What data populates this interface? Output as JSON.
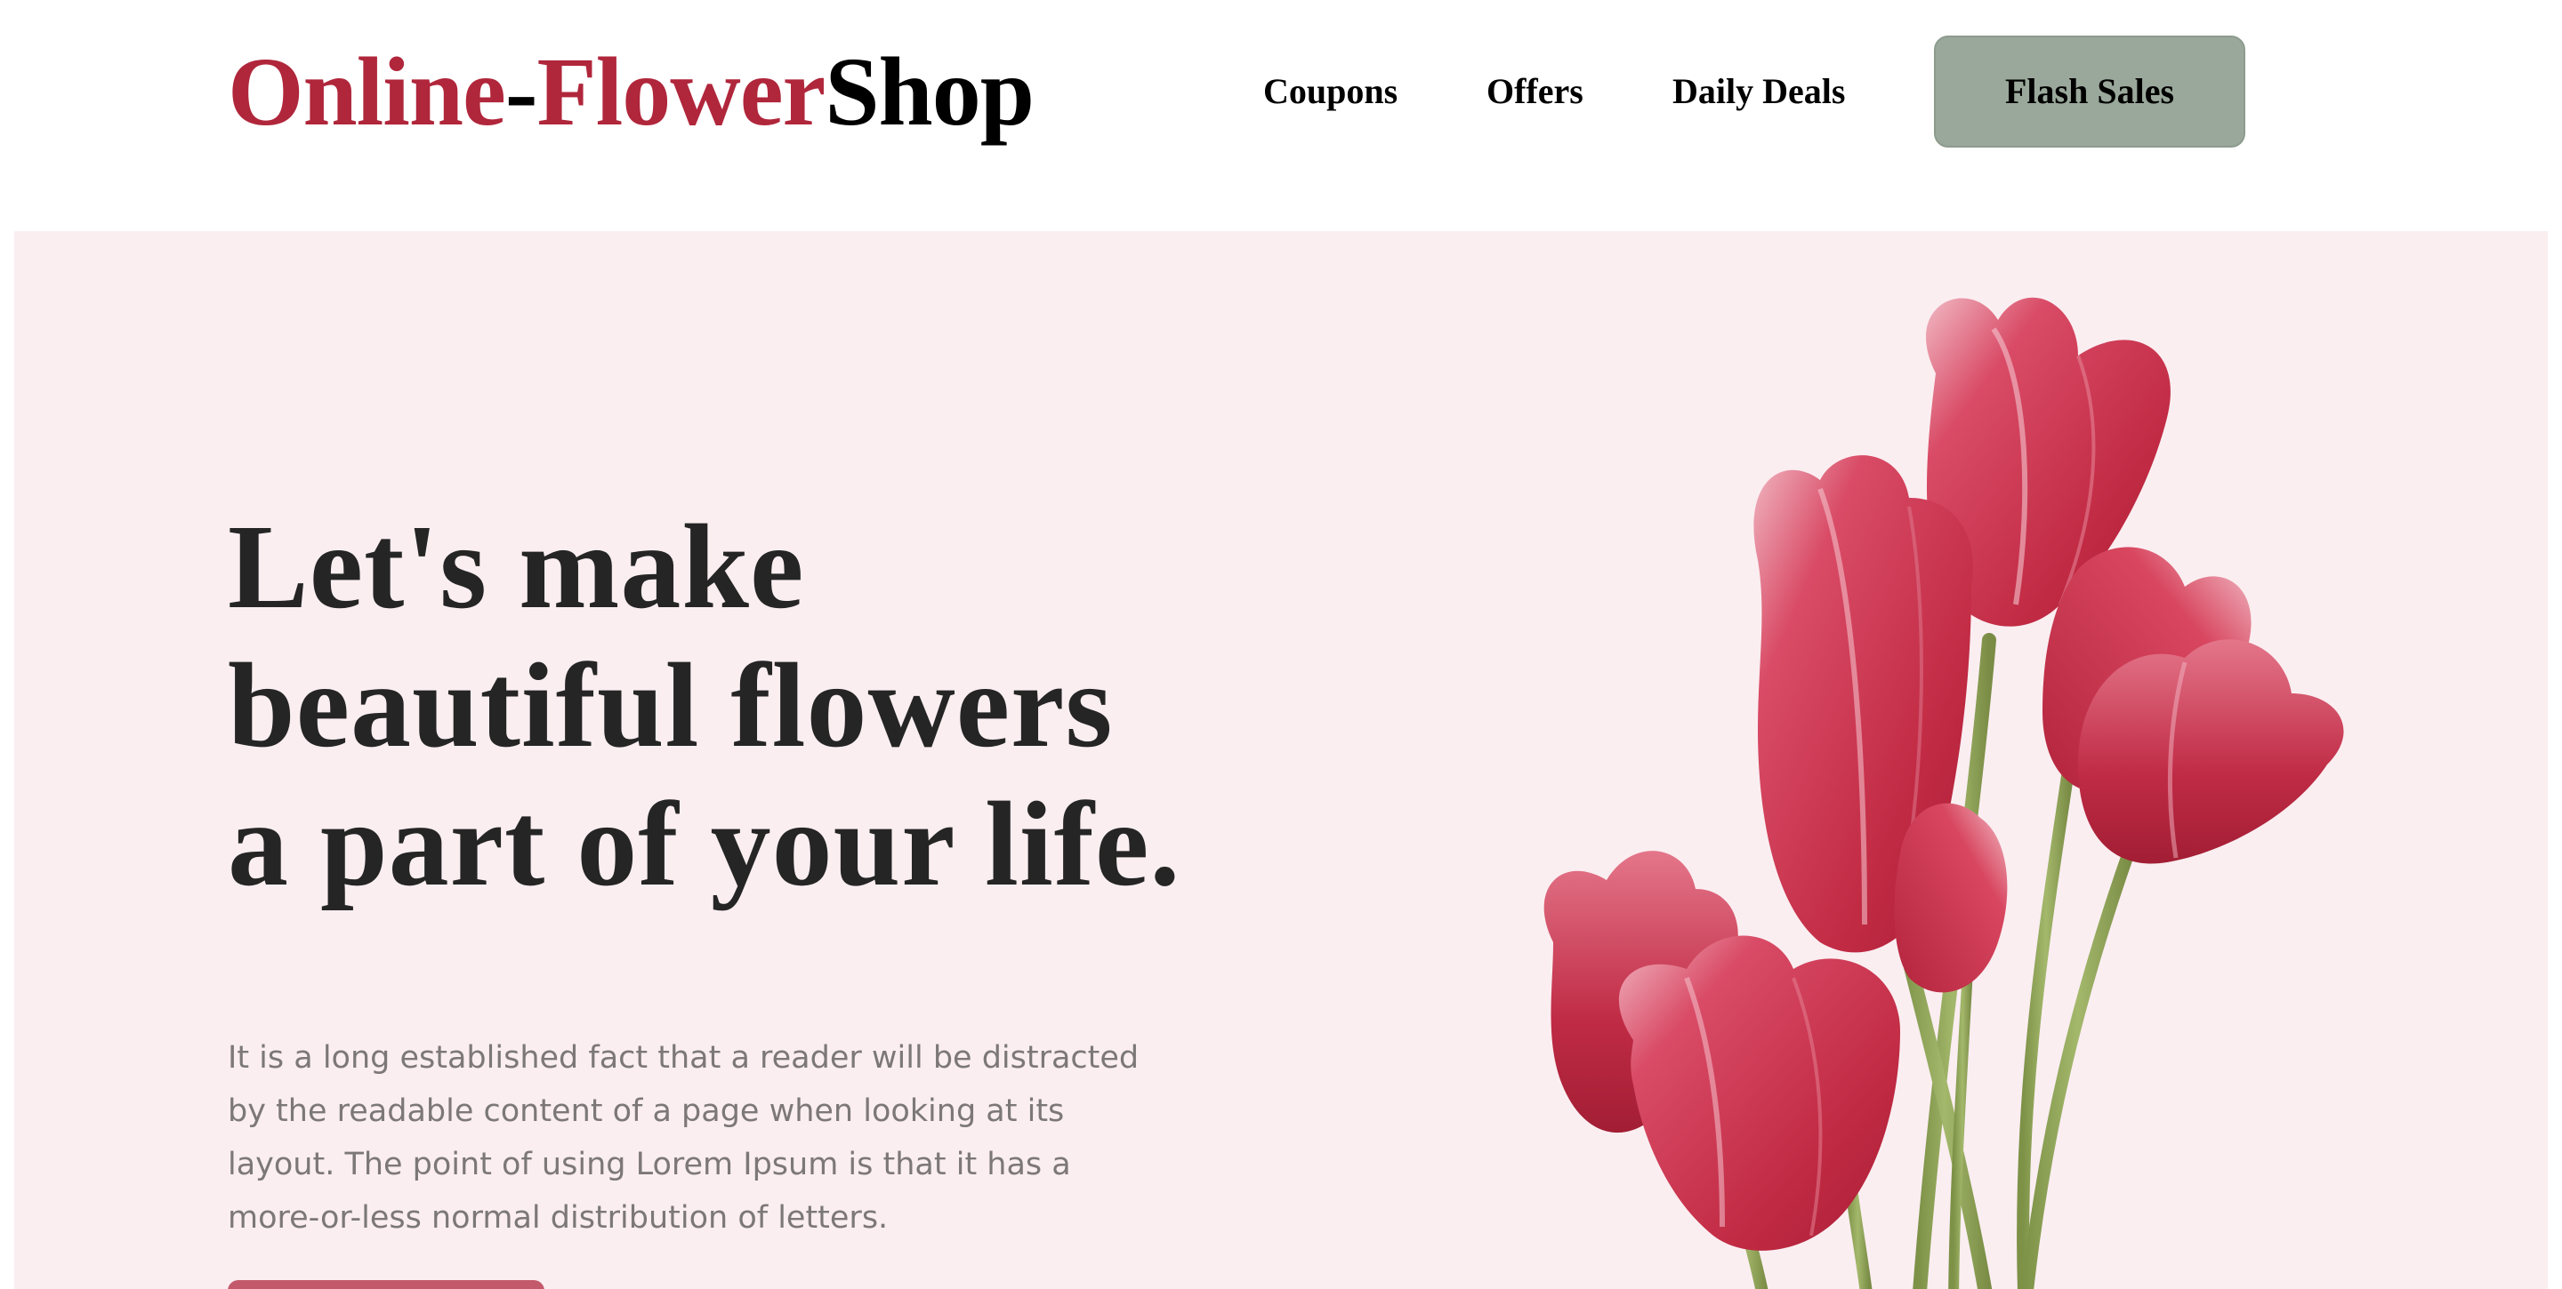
{
  "header": {
    "logo": {
      "part1": "Online",
      "dash": "-",
      "part2": "Flower",
      "part3": "Shop"
    },
    "nav": {
      "coupons": "Coupons",
      "offers": "Offers",
      "daily_deals": "Daily Deals",
      "flash_sales": "Flash Sales"
    }
  },
  "hero": {
    "title_line1": "Let's make",
    "title_line2": "beautiful flowers",
    "title_line3": "a part of your life.",
    "paragraph": "It is a long established fact that a reader will be distracted by the readable content of a page when looking at its layout. The point of using Lorem Ipsum is that it has a more-or-less normal distribution of letters.",
    "image_subject": "pink-tulips-bouquet"
  },
  "colors": {
    "brand_red": "#b0263b",
    "hero_background": "#faeef1",
    "flash_button": "#9aa89b",
    "cta_button": "#c35a6c",
    "tulip_pink": "#c8324a",
    "stem_green": "#8ea25a"
  }
}
